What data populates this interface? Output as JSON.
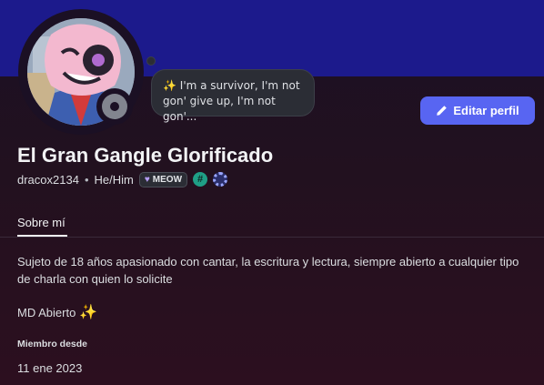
{
  "colors": {
    "banner": "#1c1a8c",
    "accent_button": "#5865f2",
    "status_offline": "#82858f"
  },
  "avatar": {
    "icon": "avatar-character-illustration"
  },
  "status": {
    "icon": "offline-status-icon"
  },
  "custom_status": {
    "emoji": "✨",
    "text": "I'm a survivor, I'm not gon' give up, I'm not gon'..."
  },
  "edit_button": {
    "icon": "pencil-icon",
    "label": "Editar perfil"
  },
  "profile": {
    "display_name": "El Gran Gangle Glorificado",
    "username": "dracox2134",
    "separator": "•",
    "pronouns": "He/Him",
    "clan_tag": "MEOW",
    "badges": [
      "hash-badge-icon",
      "quest-badge-icon"
    ]
  },
  "tabs": [
    {
      "label": "Sobre mí",
      "selected": true
    }
  ],
  "about": {
    "bio": "Sujeto de 18 años apasionado con cantar, la escritura y lectura, siempre abierto a cualquier tipo de charla con quien lo solicite",
    "dm_text": "MD Abierto",
    "dm_emoji": "✨"
  },
  "member_since": {
    "label": "Miembro desde",
    "value": "11 ene 2023"
  }
}
